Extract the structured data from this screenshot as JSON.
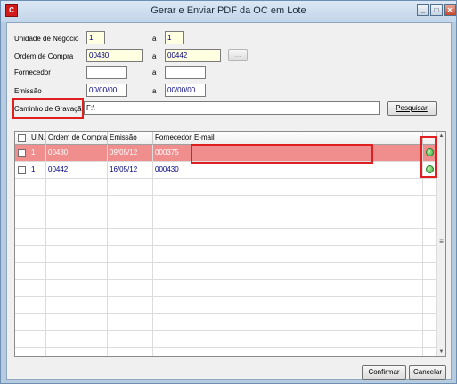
{
  "window": {
    "title": "Gerar e Enviar PDF da OC em Lote",
    "app_icon_glyph": "C",
    "minimize_glyph": "_",
    "maximize_glyph": "□",
    "close_glyph": "✕"
  },
  "form": {
    "unidade_label": "Unidade de Negócio",
    "unidade_from": "1",
    "unidade_to": "1",
    "ordem_label": "Ordem de Compra",
    "ordem_from": "00430",
    "ordem_to": "00442",
    "ordem_lookup_label": "...",
    "fornecedor_label": "Fornecedor",
    "fornecedor_from": "",
    "fornecedor_to": "",
    "emissao_label": "Emissão",
    "emissao_from": "00/00/00",
    "emissao_to": "00/00/00",
    "a_label": "a",
    "caminho_label": "Caminho de Gravação",
    "caminho_value": "F:\\",
    "pesquisar_label": "Pesquisar"
  },
  "grid": {
    "columns": [
      "",
      "U.N.",
      "Ordem de Compra",
      "Emissão",
      "Fornecedor",
      "E-mail",
      ""
    ],
    "rows": [
      {
        "un": "1",
        "ordem": "00430",
        "emissao": "09/05/12",
        "fornecedor": "000375",
        "email": "",
        "status_icon": "status-ok-icon"
      },
      {
        "un": "1",
        "ordem": "00442",
        "emissao": "16/05/12",
        "fornecedor": "000430",
        "email": "",
        "status_icon": "status-ok-icon"
      }
    ],
    "scroll_up": "▲",
    "scroll_down": "▼",
    "scroll_grip": "≡"
  },
  "footer": {
    "confirmar_label": "Confirmar",
    "cancelar_label": "Cancelar"
  },
  "colors": {
    "selected_row": "#f08d8d",
    "highlight_border": "#e02020",
    "row_text_blue": "#000080",
    "status_green": "#36a83a"
  }
}
